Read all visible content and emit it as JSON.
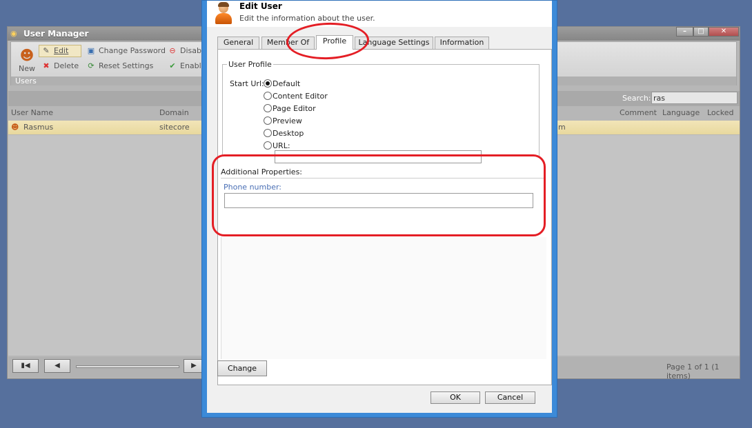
{
  "background_window": {
    "title": "User Manager",
    "ribbon": {
      "new_label": "New",
      "edit_label": "Edit",
      "delete_label": "Delete",
      "change_password_label": "Change Password",
      "reset_settings_label": "Reset Settings",
      "disable_label": "Disable",
      "enable_label": "Enable",
      "group_label": "Users"
    },
    "search": {
      "label": "Search:",
      "value": "ras"
    },
    "columns": {
      "user_name": "User Name",
      "domain": "Domain",
      "comment": "Comment",
      "language": "Language",
      "locked": "Locked"
    },
    "rows": [
      {
        "user_name": "Rasmus",
        "domain": "sitecore",
        "email_tail": "m"
      }
    ],
    "pager": {
      "info": "Page 1 of 1 (1 items)"
    }
  },
  "dialog": {
    "title": "Edit User",
    "subtitle": "Edit the information about the user.",
    "tabs": [
      {
        "label": "General"
      },
      {
        "label": "Member Of"
      },
      {
        "label": "Profile",
        "active": true
      },
      {
        "label": "Language Settings"
      },
      {
        "label": "Information"
      }
    ],
    "profile": {
      "legend": "User Profile",
      "start_url_label": "Start Url:",
      "options": [
        {
          "label": "Default",
          "checked": true
        },
        {
          "label": "Content Editor"
        },
        {
          "label": "Page Editor"
        },
        {
          "label": "Preview"
        },
        {
          "label": "Desktop"
        },
        {
          "label": "URL:"
        }
      ],
      "url_value": ""
    },
    "additional": {
      "title": "Additional Properties:",
      "phone_label": "Phone number:",
      "phone_value": ""
    },
    "buttons": {
      "change": "Change",
      "ok": "OK",
      "cancel": "Cancel"
    }
  },
  "colors": {
    "desktop": "#56709d",
    "dialog_frame": "#3c8ad8",
    "annotation": "#e41e25",
    "selected_row": "#f2e5b8"
  }
}
